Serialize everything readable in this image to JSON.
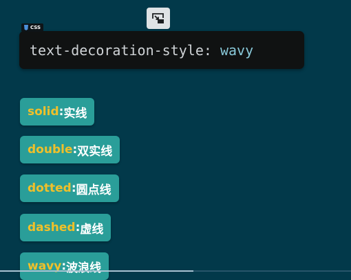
{
  "toolbar": {
    "button_icon": "picture-in-picture-exit-icon"
  },
  "code_block": {
    "language_label": "CSS",
    "language_icon": "css-shield-icon",
    "property": "text-decoration-style",
    "colon": ": ",
    "value": "wavy"
  },
  "options": [
    {
      "keyword": "solid",
      "separator": ": ",
      "description": "实线"
    },
    {
      "keyword": "double",
      "separator": ": ",
      "description": "双实线"
    },
    {
      "keyword": "dotted",
      "separator": ": ",
      "description": "圆点线"
    },
    {
      "keyword": "dashed",
      "separator": ": ",
      "description": "虚线"
    },
    {
      "keyword": "wavy",
      "separator": ": ",
      "description": "波浪线"
    }
  ],
  "video_progress": {
    "fraction": 0.55
  },
  "colors": {
    "background": "#02394a",
    "code_background": "#101212",
    "code_text": "#cfd3d6",
    "code_value": "#88c8d8",
    "pill_background": "#2a9e99",
    "keyword": "#f0c02a",
    "description": "#ffffff"
  }
}
